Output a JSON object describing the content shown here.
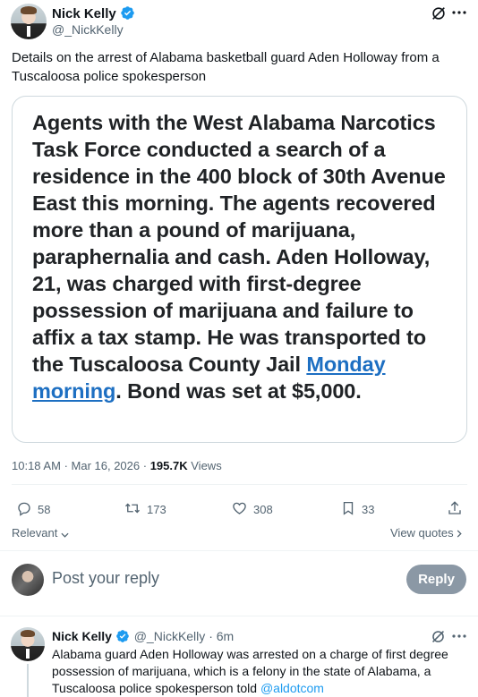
{
  "tweet": {
    "author_name": "Nick Kelly",
    "author_handle": "@_NickKelly",
    "text": "Details on the arrest of Alabama basketball guard Aden Holloway from a Tuscaloosa police spokesperson",
    "image_text_part1": "Agents with the West Alabama Narcotics Task Force conducted a search of a residence in the 400 block of 30th Avenue East this morning. The agents recovered more than a pound of marijuana, paraphernalia and cash. Aden Holloway, 21, was charged with first-degree possession of marijuana and failure to affix a tax stamp. He was transported to the Tuscaloosa County Jail ",
    "image_text_link": "Monday morning",
    "image_text_part2": ". Bond was set at $5,000.",
    "time": "10:18 AM",
    "date": "Mar 16, 2026",
    "views_count": "195.7K",
    "views_label": "Views",
    "replies": "58",
    "retweets": "173",
    "likes": "308",
    "bookmarks": "33",
    "sort_label": "Relevant",
    "view_quotes_label": "View quotes"
  },
  "composer": {
    "placeholder": "Post your reply",
    "reply_button": "Reply"
  },
  "reply": {
    "author_name": "Nick Kelly",
    "author_handle": "@_NickKelly",
    "time_ago": "6m",
    "text": "Alabama guard Aden Holloway was arrested on a charge of first degree possession of marijuana, which is a felony in the state of Alabama, a Tuscaloosa police spokesperson told ",
    "mention": "@aldotcom"
  },
  "colors": {
    "link": "#1d9bf0",
    "verified": "#1d9bf0",
    "muted": "#536471",
    "reply_button_bg": "#8b98a5"
  }
}
